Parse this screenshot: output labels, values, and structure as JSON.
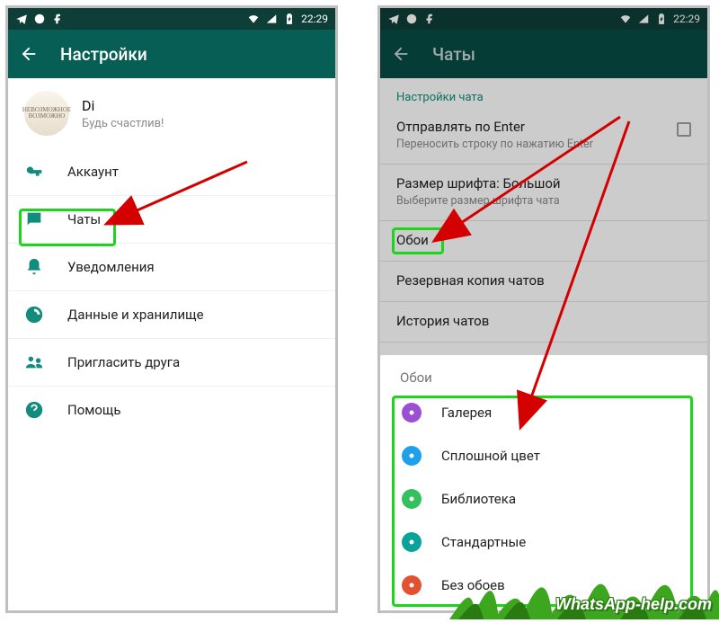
{
  "status": {
    "time": "22:29",
    "icons_left": [
      "telegram-icon",
      "uc-icon",
      "facebook-icon"
    ],
    "icons_right": [
      "wifi-icon",
      "signal-icon",
      "battery-charging-icon"
    ]
  },
  "phone_left": {
    "appbar_title": "Настройки",
    "profile": {
      "name": "Di",
      "status": "Будь счастлив!"
    },
    "items": [
      {
        "icon": "key-icon",
        "label": "Аккаунт"
      },
      {
        "icon": "chat-icon",
        "label": "Чаты"
      },
      {
        "icon": "bell-icon",
        "label": "Уведомления"
      },
      {
        "icon": "data-icon",
        "label": "Данные и хранилище"
      },
      {
        "icon": "invite-icon",
        "label": "Пригласить друга"
      },
      {
        "icon": "help-icon",
        "label": "Помощь"
      }
    ]
  },
  "phone_right": {
    "appbar_title": "Чаты",
    "section_title": "Настройки чата",
    "items": [
      {
        "primary": "Отправлять по Enter",
        "secondary": "Переносить строку по нажатию Enter",
        "checkbox": true
      },
      {
        "primary": "Размер шрифта: Большой",
        "secondary": "Выберите размер шрифта чата"
      },
      {
        "primary": "Обои"
      },
      {
        "primary": "Резервная копия чатов"
      },
      {
        "primary": "История чатов"
      }
    ],
    "sheet": {
      "title": "Обои",
      "options": [
        {
          "color": "#9b4fd3",
          "label": "Галерея"
        },
        {
          "color": "#1fa0ea",
          "label": "Сплошной цвет"
        },
        {
          "color": "#33c15f",
          "label": "Библиотека"
        },
        {
          "color": "#0aa39b",
          "label": "Стандартные"
        },
        {
          "color": "#e35230",
          "label": "Без обоев"
        }
      ]
    }
  },
  "watermark": "WhatsApp-help.com"
}
